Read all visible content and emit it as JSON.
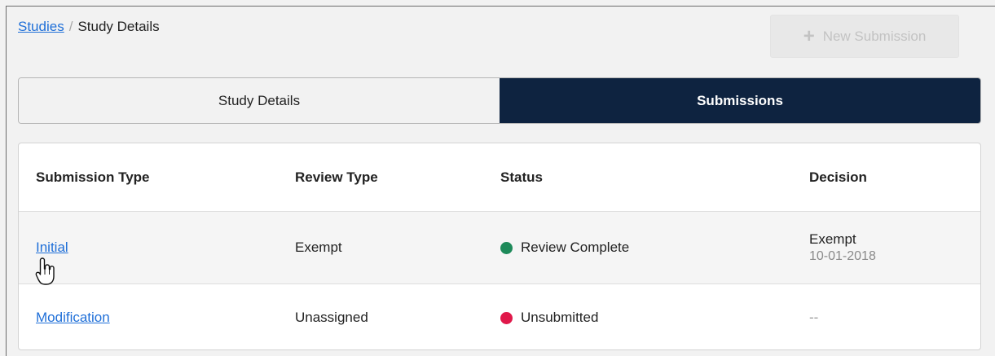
{
  "breadcrumb": {
    "root": "Studies",
    "separator": "/",
    "current": "Study Details"
  },
  "toolbar": {
    "new_submission_label": "New Submission",
    "new_submission_icon": "+"
  },
  "tabs": [
    {
      "label": "Study Details",
      "active": false
    },
    {
      "label": "Submissions",
      "active": true
    }
  ],
  "table": {
    "columns": [
      "Submission Type",
      "Review Type",
      "Status",
      "Decision"
    ],
    "rows": [
      {
        "submission_type": "Initial",
        "review_type": "Exempt",
        "status": "Review Complete",
        "status_color": "#1e8a5a",
        "decision": "Exempt",
        "decision_date": "10-01-2018"
      },
      {
        "submission_type": "Modification",
        "review_type": "Unassigned",
        "status": "Unsubmitted",
        "status_color": "#e0184a",
        "decision": "--",
        "decision_date": ""
      }
    ]
  },
  "colors": {
    "active_tab": "#0e2340",
    "link": "#1f6fd8"
  }
}
